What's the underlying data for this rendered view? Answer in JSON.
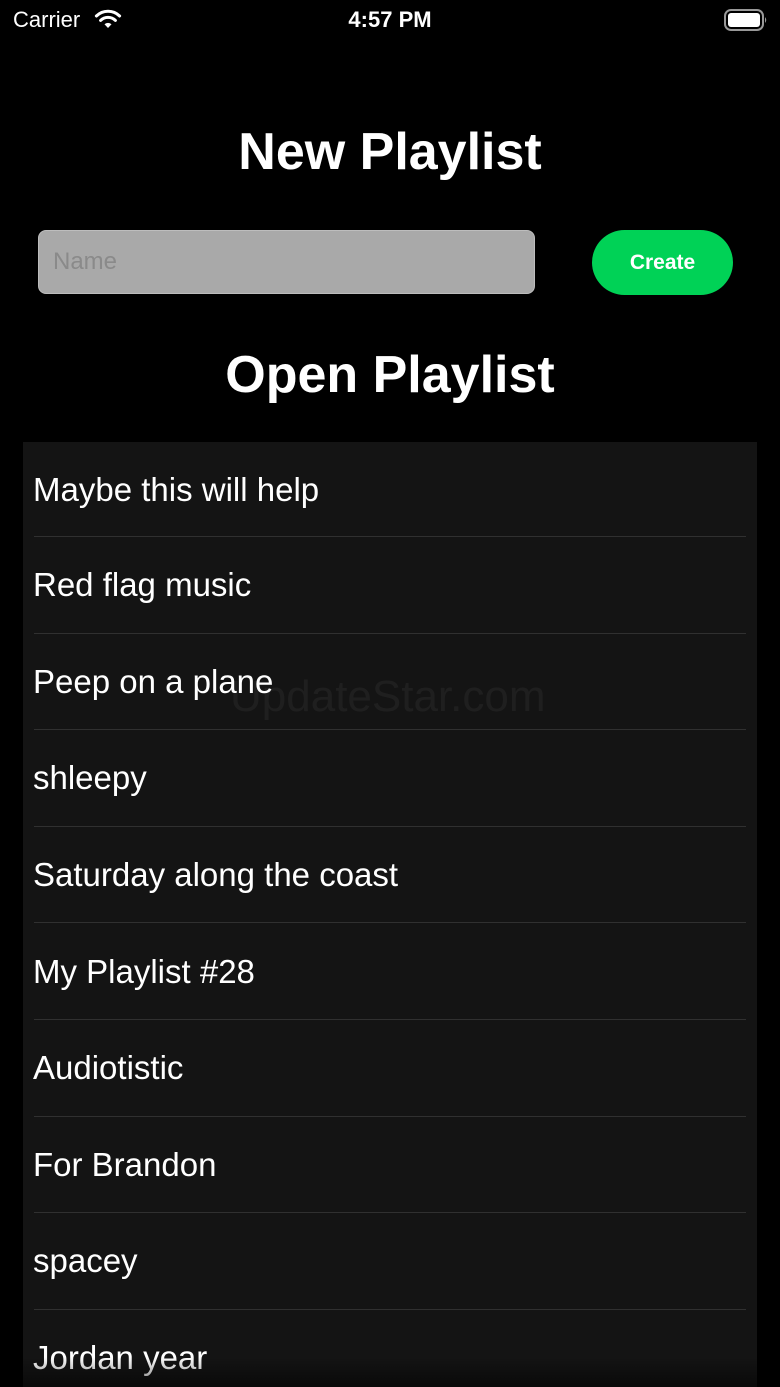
{
  "status_bar": {
    "carrier": "Carrier",
    "time": "4:57 PM",
    "wifi_icon": "wifi-icon",
    "battery_icon": "battery-icon"
  },
  "new_playlist": {
    "title": "New Playlist",
    "name_placeholder": "Name",
    "name_value": "",
    "create_label": "Create",
    "create_color": "#00d256"
  },
  "open_playlist": {
    "title": "Open Playlist",
    "items": [
      {
        "label": "Maybe this will help"
      },
      {
        "label": "Red flag music"
      },
      {
        "label": "Peep on a plane"
      },
      {
        "label": "shleepy"
      },
      {
        "label": "Saturday along the coast"
      },
      {
        "label": "My Playlist #28"
      },
      {
        "label": "Audiotistic"
      },
      {
        "label": "For Brandon"
      },
      {
        "label": "spacey"
      },
      {
        "label": "Jordan year"
      }
    ]
  },
  "watermark": "UpdateStar.com",
  "colors": {
    "background": "#000000",
    "list_background": "#141414",
    "divider": "#303030",
    "input_background": "#a9a9a9"
  }
}
